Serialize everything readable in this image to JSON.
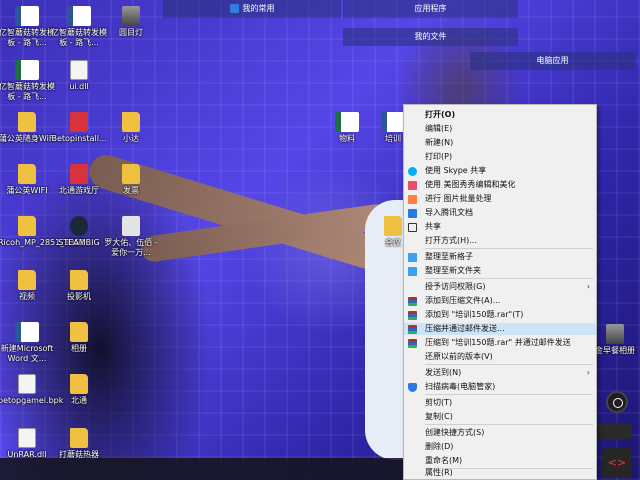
{
  "top_tabs": {
    "my_common": "我的常用",
    "apps": "应用程序",
    "my_files": "我的文件",
    "pc_apps": "电脑应用"
  },
  "desktop_icons": [
    {
      "label": "亿智蘑菇转发模板 - 路飞...",
      "icon": "word-icon"
    },
    {
      "label": "亿智蘑菇转发模板 - 路飞...",
      "icon": "word-icon"
    },
    {
      "label": "圆目灯",
      "icon": "image-icon"
    },
    {
      "label": "亿智蘑菇转发模板 - 路飞...",
      "icon": "excel-icon"
    },
    {
      "label": "ui.dll",
      "icon": "file-icon"
    },
    {
      "label": "蒲公英随身WiFi",
      "icon": "folder-icon"
    },
    {
      "label": "Betopinstall...",
      "icon": "betop-icon"
    },
    {
      "label": "小达",
      "icon": "folder-icon"
    },
    {
      "label": "物料",
      "icon": "excel-icon"
    },
    {
      "label": "培训",
      "icon": "word-icon"
    },
    {
      "label": "蒲公英WIFI",
      "icon": "folder-icon"
    },
    {
      "label": "北通游戏厅",
      "icon": "betop-icon"
    },
    {
      "label": "发票",
      "icon": "folder-icon"
    },
    {
      "label": "Ricoh_MP_2851_3351",
      "icon": "folder-icon"
    },
    {
      "label": "STEAMBIG",
      "icon": "steam-icon"
    },
    {
      "label": "罗大佑、伍佰 - 爱你一万...",
      "icon": "music-icon"
    },
    {
      "label": "会议",
      "icon": "folder-icon"
    },
    {
      "label": "视频",
      "icon": "folder-icon"
    },
    {
      "label": "投影机",
      "icon": "folder-icon"
    },
    {
      "label": "新建Microsoft Word 文...",
      "icon": "word-icon"
    },
    {
      "label": "相册",
      "icon": "folder-icon"
    },
    {
      "label": "betopgamei.bpk",
      "icon": "file-icon"
    },
    {
      "label": "北通",
      "icon": "folder-icon"
    },
    {
      "label": "UnRAR.dll",
      "icon": "file-icon"
    },
    {
      "label": "打蘑菇热器",
      "icon": "folder-icon"
    },
    {
      "label": "金早餐相册",
      "icon": "image-icon"
    }
  ],
  "context_menu": {
    "items": [
      {
        "label": "打开(O)",
        "bold": true
      },
      {
        "label": "编辑(E)"
      },
      {
        "label": "新建(N)"
      },
      {
        "label": "打印(P)"
      },
      {
        "label": "使用 Skype 共享",
        "icon": "skype-icon"
      },
      {
        "label": "使用 美图秀秀编辑和美化",
        "icon": "meitu-icon"
      },
      {
        "label": "进行 图片批量处理",
        "icon": "batch-icon"
      },
      {
        "label": "导入腾讯文档",
        "icon": "tencent-docs-icon"
      },
      {
        "label": "共享",
        "icon": "share-icon"
      },
      {
        "label": "打开方式(H)..."
      },
      {
        "label": "整理至新格子",
        "icon": "grid-icon"
      },
      {
        "label": "整理至新文件夹",
        "icon": "folder-icon"
      },
      {
        "label": "授予访问权限(G)",
        "submenu": true
      },
      {
        "label": "添加到压缩文件(A)...",
        "icon": "winrar-icon"
      },
      {
        "label": "添加到 \"培训150题.rar\"(T)",
        "icon": "winrar-icon"
      },
      {
        "label": "压缩并通过邮件发送...",
        "icon": "winrar-icon",
        "highlighted": true
      },
      {
        "label": "压缩到 \"培训150题.rar\" 并通过邮件发送",
        "icon": "winrar-icon"
      },
      {
        "label": "还原以前的版本(V)"
      },
      {
        "label": "发送到(N)",
        "submenu": true
      },
      {
        "label": "扫描病毒(电脑管家)",
        "icon": "shield-icon"
      },
      {
        "label": "剪切(T)"
      },
      {
        "label": "复制(C)"
      },
      {
        "label": "创建快捷方式(S)"
      },
      {
        "label": "删除(D)"
      },
      {
        "label": "重命名(M)"
      },
      {
        "label": "属性(R)"
      }
    ]
  },
  "colors": {
    "menu_bg": "#f0f0f0",
    "menu_highlight": "#cce4f7",
    "desktop_blue": "#4a3fd6"
  }
}
